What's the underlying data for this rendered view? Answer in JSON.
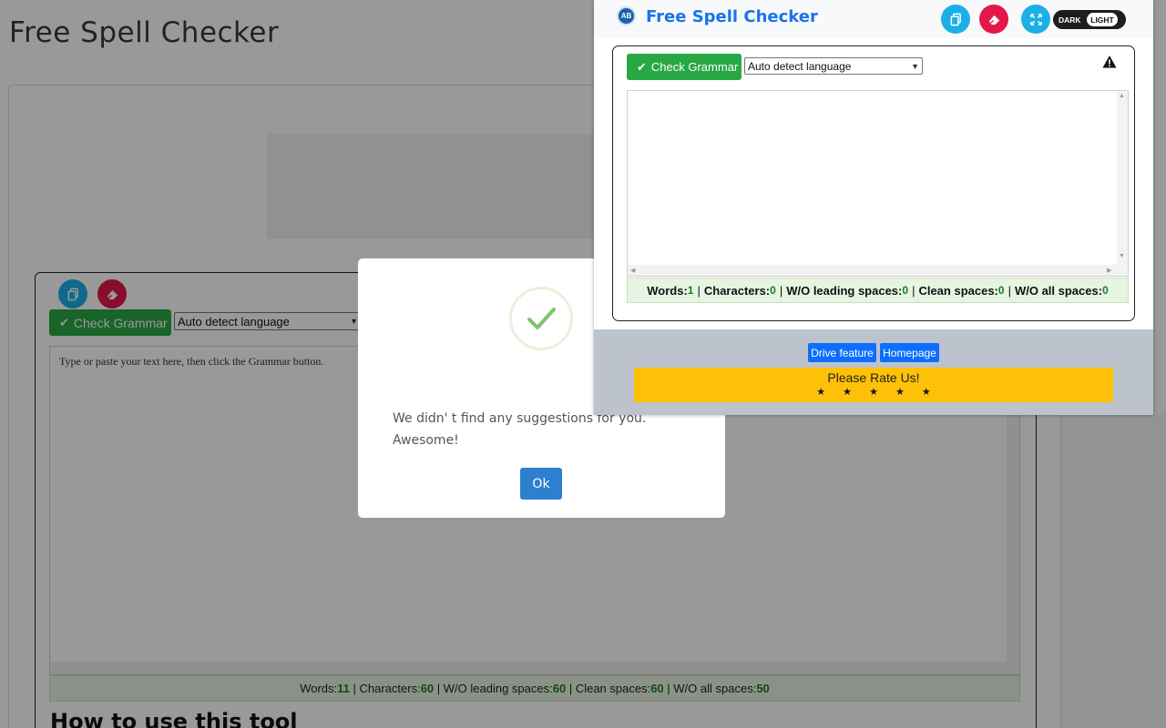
{
  "page": {
    "title": "Free Spell Checker",
    "heading_howto": "How to use this tool"
  },
  "tool": {
    "check_label": "Check Grammar",
    "language": "Auto detect language",
    "placeholder": "Type or paste your text here, then click the Grammar button.",
    "stats": {
      "words_label": "Words:",
      "words": "11",
      "chars_label": "Characters:",
      "chars": "60",
      "lead_label": "W/O leading spaces:",
      "lead": "60",
      "clean_label": "Clean spaces:",
      "clean": "60",
      "all_label": "W/O all spaces:",
      "all": "50"
    }
  },
  "modal": {
    "message": "We didn' t find any suggestions for you. Awesome!",
    "ok_label": "Ok",
    "icon": "check-icon"
  },
  "popup": {
    "title": "Free Spell Checker",
    "toggle_dark": "DARK",
    "toggle_light": "LIGHT",
    "check_label": "Check Grammar",
    "language": "Auto detect language",
    "stats": {
      "words_label": "Words:",
      "words": "1",
      "chars_label": "Characters:",
      "chars": "0",
      "lead_label": "W/O leading spaces:",
      "lead": "0",
      "clean_label": "Clean spaces:",
      "clean": "0",
      "all_label": "W/O all spaces:",
      "all": "0"
    },
    "footer": {
      "drive_label": "Drive feature",
      "homepage_label": "Homepage",
      "rate_label": "Please Rate Us!",
      "stars": "★ ★ ★ ★ ★"
    }
  },
  "colors": {
    "accent_blue": "#1a73e8",
    "check_green": "#28a745",
    "copy_cyan": "#1ab0e6",
    "erase_red": "#e4174a",
    "ok_blue": "#2d80d0",
    "rate_yellow": "#ffc107"
  }
}
